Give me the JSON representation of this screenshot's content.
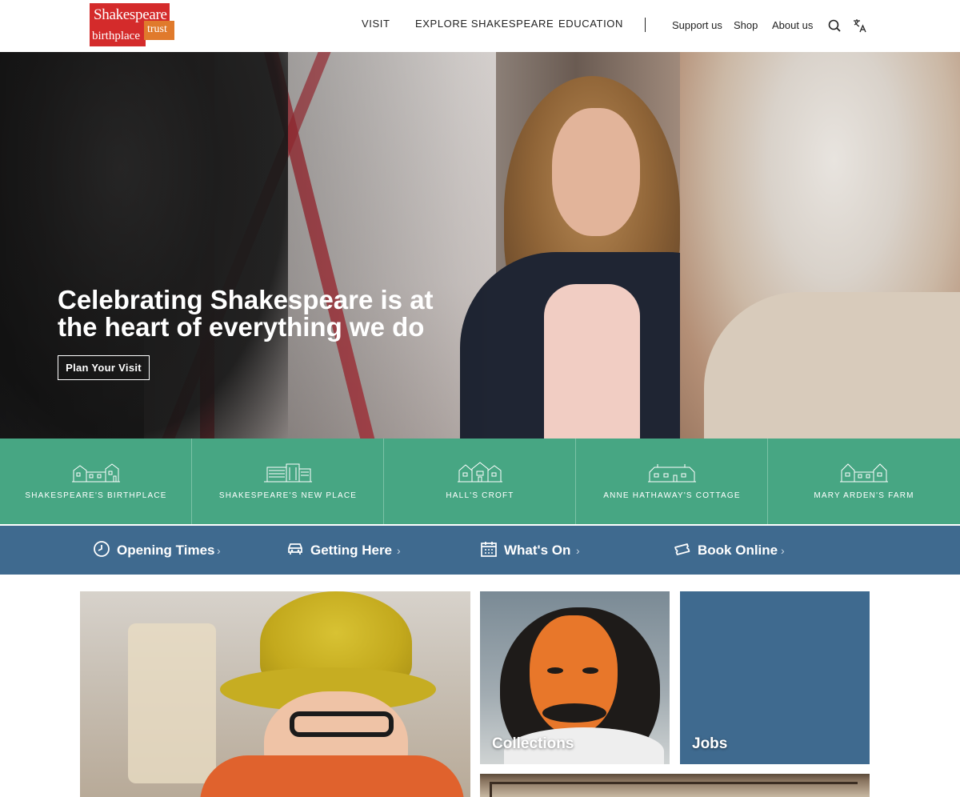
{
  "header": {
    "logo": {
      "line1": "Shakespeare",
      "line2": "birthplace",
      "line3": "trust"
    },
    "main_nav": [
      "VISIT",
      "EXPLORE SHAKESPEARE",
      "EDUCATION"
    ],
    "sub_nav": [
      "Support us",
      "Shop",
      "About us"
    ],
    "icons": [
      "search-icon",
      "translate-icon"
    ]
  },
  "hero": {
    "title": "Celebrating Shakespeare is at the heart of everything we do",
    "button": "Plan Your Visit"
  },
  "houses": [
    {
      "label": "SHAKESPEARE'S BIRTHPLACE",
      "icon": "birthplace-house-icon"
    },
    {
      "label": "SHAKESPEARE'S NEW PLACE",
      "icon": "new-place-house-icon"
    },
    {
      "label": "HALL'S CROFT",
      "icon": "halls-croft-house-icon"
    },
    {
      "label": "ANNE HATHAWAY'S COTTAGE",
      "icon": "cottage-house-icon"
    },
    {
      "label": "MARY ARDEN'S FARM",
      "icon": "farm-house-icon"
    }
  ],
  "quicklinks": [
    {
      "label": "Opening Times",
      "icon": "clock-icon"
    },
    {
      "label": "Getting Here",
      "icon": "car-icon"
    },
    {
      "label": "What's On",
      "icon": "calendar-icon"
    },
    {
      "label": "Book Online",
      "icon": "ticket-icon"
    }
  ],
  "tiles": {
    "collections": "Collections",
    "jobs": "Jobs"
  },
  "colors": {
    "brand_red": "#d42b2b",
    "brand_orange": "#e07a2c",
    "houses_green": "#47a683",
    "info_blue": "#3f6a8f"
  }
}
